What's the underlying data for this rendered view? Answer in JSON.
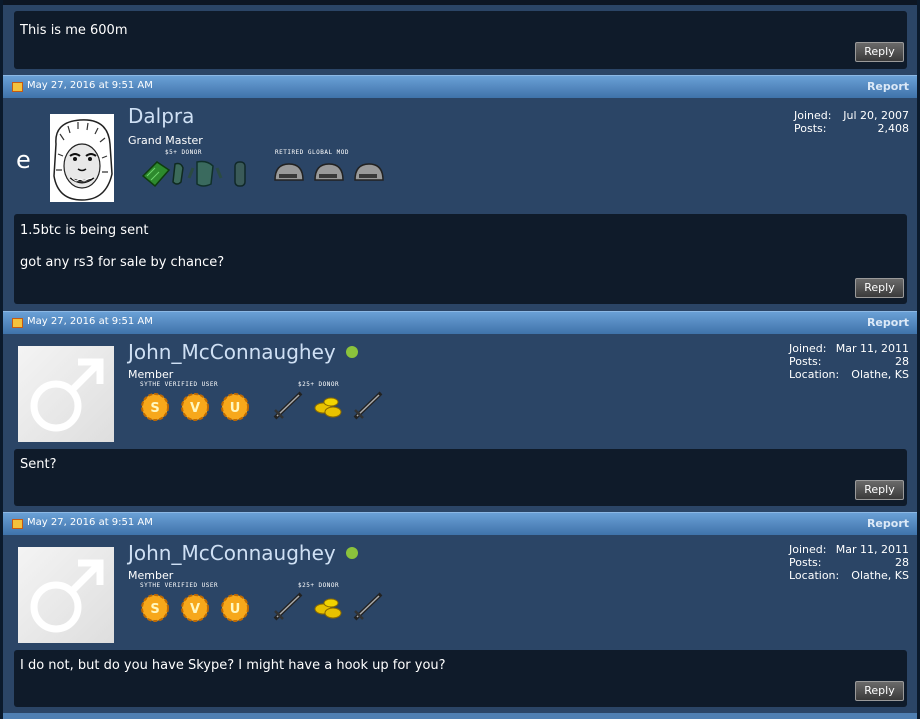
{
  "post0": {
    "message": "This is me 600m",
    "reply_label": "Reply"
  },
  "posts": [
    {
      "date": "May 27, 2016 at 9:51 AM",
      "report_label": "Report",
      "username": "Dalpra",
      "side_letter": "e",
      "user_title": "Grand Master",
      "badge_group1_label": "$5+ DONOR",
      "badge_group2_label": "RETIRED GLOBAL MOD",
      "stats": [
        {
          "key": "Joined:",
          "value": "Jul 20, 2007"
        },
        {
          "key": "Posts:",
          "value": "2,408"
        }
      ],
      "message": "1.5btc is being sent\n\ngot any rs3 for sale by chance?",
      "reply_label": "Reply",
      "online": false
    },
    {
      "date": "May 27, 2016 at 9:51 AM",
      "report_label": "Report",
      "username": "John_McConnaughey",
      "user_title": "Member",
      "badge_group1_label": "SYTHE VERIFIED USER",
      "badge_group2_label": "$25+ DONOR",
      "badge_letters": [
        "S",
        "V",
        "U"
      ],
      "stats": [
        {
          "key": "Joined:",
          "value": "Mar 11, 2011"
        },
        {
          "key": "Posts:",
          "value": "28"
        },
        {
          "key": "Location:",
          "value": "Olathe, KS"
        }
      ],
      "message": "Sent?",
      "reply_label": "Reply",
      "online": true
    },
    {
      "date": "May 27, 2016 at 9:51 AM",
      "report_label": "Report",
      "username": "John_McConnaughey",
      "user_title": "Member",
      "badge_group1_label": "SYTHE VERIFIED USER",
      "badge_group2_label": "$25+ DONOR",
      "badge_letters": [
        "S",
        "V",
        "U"
      ],
      "stats": [
        {
          "key": "Joined:",
          "value": "Mar 11, 2011"
        },
        {
          "key": "Posts:",
          "value": "28"
        },
        {
          "key": "Location:",
          "value": "Olathe, KS"
        }
      ],
      "message": "I do not, but do you have Skype? I might have a hook up for you?",
      "reply_label": "Reply",
      "online": true
    }
  ],
  "colors": {
    "header_gradient_top": "#6aa0d6",
    "header_gradient_bottom": "#3f73aa",
    "post_background": "#2b4566",
    "message_background": "#0f1b2a",
    "online_indicator": "#8bc33c"
  }
}
